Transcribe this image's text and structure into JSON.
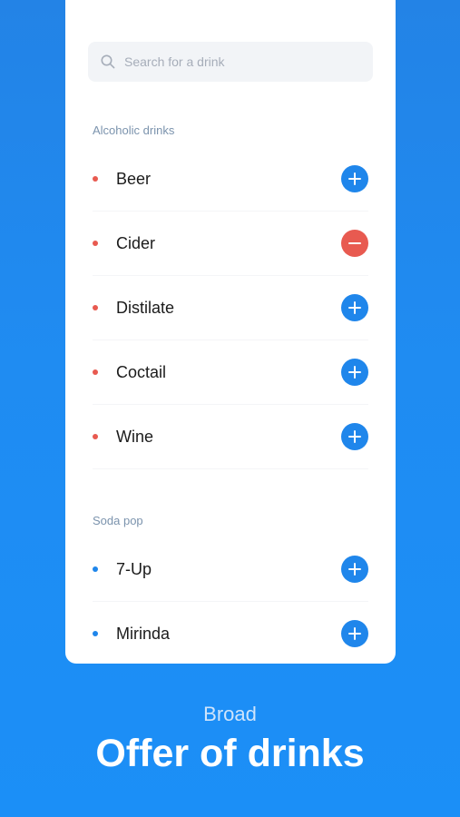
{
  "search": {
    "placeholder": "Search for a drink",
    "icon": "search-icon"
  },
  "sections": [
    {
      "title": "Alcoholic drinks",
      "dot_color": "#e85a50",
      "items": [
        {
          "label": "Beer",
          "action": "add"
        },
        {
          "label": "Cider",
          "action": "remove"
        },
        {
          "label": "Distilate",
          "action": "add"
        },
        {
          "label": "Coctail",
          "action": "add"
        },
        {
          "label": "Wine",
          "action": "add"
        }
      ]
    },
    {
      "title": "Soda pop",
      "dot_color": "#1f86eb",
      "items": [
        {
          "label": "7-Up",
          "action": "add"
        },
        {
          "label": "Mirinda",
          "action": "add"
        }
      ]
    }
  ],
  "caption": {
    "subtitle": "Broad",
    "title": "Offer of drinks"
  },
  "colors": {
    "accent": "#1f86eb",
    "remove": "#e85a50"
  }
}
